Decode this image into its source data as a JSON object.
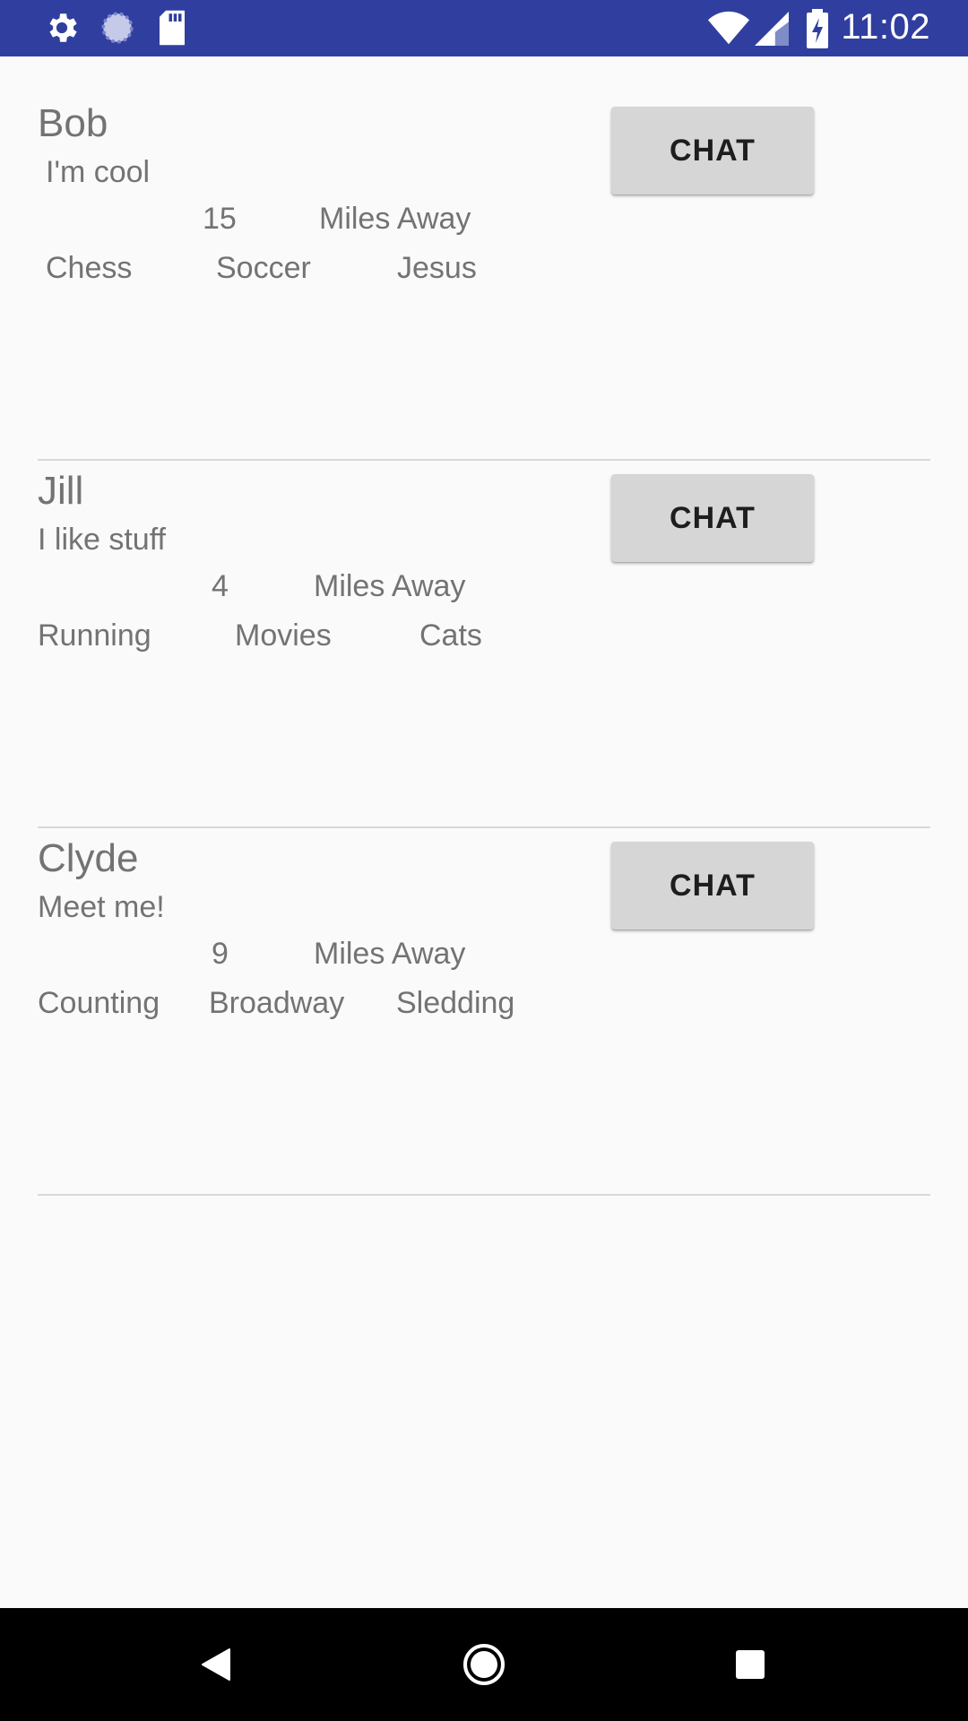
{
  "status_bar": {
    "time": "11:02",
    "left_icons": [
      "settings-icon",
      "sync-icon",
      "sd-card-icon"
    ],
    "right_icons": [
      "wifi-icon",
      "signal-icon",
      "battery-charging-icon"
    ],
    "background_color": "#303f9f"
  },
  "users": [
    {
      "name": "Bob",
      "bio": "I'm cool",
      "distance": "15",
      "distance_label": "Miles Away",
      "interests": [
        "Chess",
        "Soccer",
        "Jesus"
      ],
      "chat_label": "CHAT"
    },
    {
      "name": "Jill",
      "bio": "I like stuff",
      "distance": "4",
      "distance_label": "Miles Away",
      "interests": [
        "Running",
        "Movies",
        "Cats"
      ],
      "chat_label": "CHAT"
    },
    {
      "name": "Clyde",
      "bio": "Meet me!",
      "distance": "9",
      "distance_label": "Miles Away",
      "interests": [
        "Counting",
        "Broadway",
        "Sledding"
      ],
      "chat_label": "CHAT"
    }
  ],
  "nav_bar": {
    "buttons": [
      "back-icon",
      "home-icon",
      "recents-icon"
    ]
  }
}
